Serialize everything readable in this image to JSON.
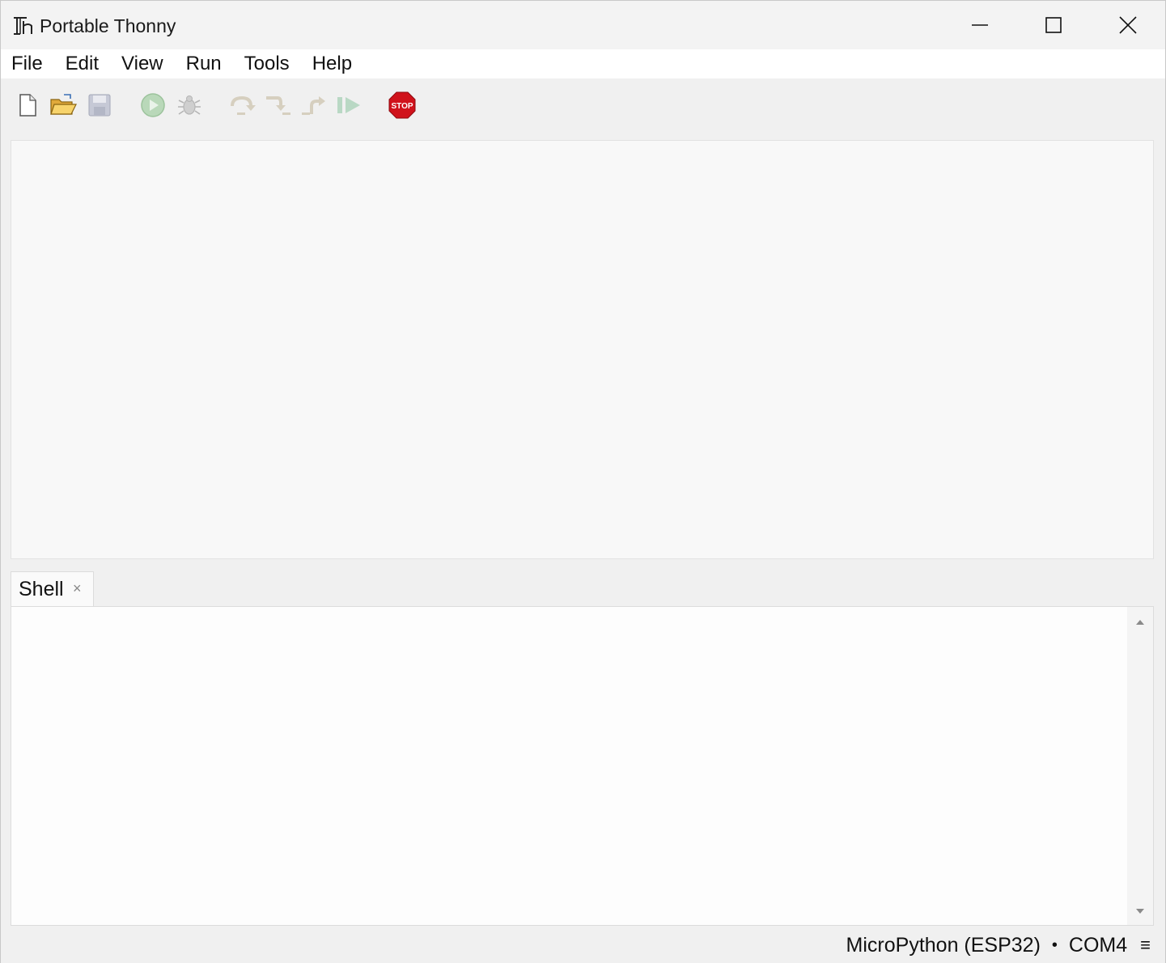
{
  "window": {
    "title": "Portable Thonny",
    "app_icon": "thonny-logo-icon",
    "controls": [
      "minimize-icon",
      "maximize-icon",
      "close-icon"
    ]
  },
  "menubar": {
    "items": [
      {
        "label": "File"
      },
      {
        "label": "Edit"
      },
      {
        "label": "View"
      },
      {
        "label": "Run"
      },
      {
        "label": "Tools"
      },
      {
        "label": "Help"
      }
    ]
  },
  "toolbar": {
    "buttons": [
      {
        "icon": "new-file-icon",
        "enabled": true
      },
      {
        "icon": "open-folder-icon",
        "enabled": true
      },
      {
        "icon": "save-icon",
        "enabled": false
      },
      {
        "icon": "run-icon",
        "enabled": false
      },
      {
        "icon": "debug-icon",
        "enabled": false
      },
      {
        "icon": "step-over-icon",
        "enabled": false
      },
      {
        "icon": "step-into-icon",
        "enabled": false
      },
      {
        "icon": "step-out-icon",
        "enabled": false
      },
      {
        "icon": "resume-icon",
        "enabled": false
      },
      {
        "icon": "stop-icon",
        "enabled": true,
        "label": "STOP"
      }
    ]
  },
  "shell": {
    "tab_label": "Shell",
    "tab_close": "×"
  },
  "statusbar": {
    "interpreter": "MicroPython (ESP32)",
    "separator": "•",
    "port": "COM4",
    "menu_glyph": "≡"
  },
  "colors": {
    "stop_red": "#d0121b",
    "run_green_disabled": "#a9cfa9",
    "editor_bg": "#f8f8f8",
    "shell_bg": "#fdfdfd"
  }
}
